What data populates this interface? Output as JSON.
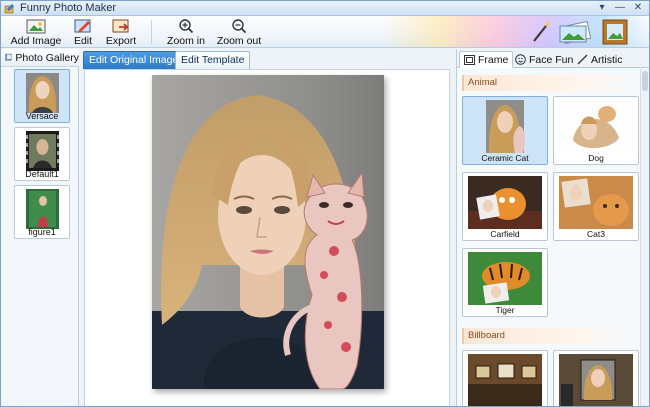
{
  "window": {
    "title": "Funny Photo Maker",
    "controls": [
      "▾",
      "—",
      "✕"
    ]
  },
  "toolbar": {
    "add_image": "Add Image",
    "edit": "Edit",
    "export": "Export",
    "zoom_in": "Zoom in",
    "zoom_out": "Zoom out"
  },
  "gallery": {
    "tab_label": "Photo Gallery",
    "items": [
      {
        "caption": "Versace",
        "selected": true
      },
      {
        "caption": "Default1",
        "selected": false
      },
      {
        "caption": "figure1",
        "selected": false
      }
    ]
  },
  "editor": {
    "tabs": [
      {
        "label": "Edit Original Image",
        "active": true
      },
      {
        "label": "Edit Template",
        "active": false
      }
    ]
  },
  "panel": {
    "tabs": [
      {
        "label": "Frame",
        "active": true
      },
      {
        "label": "Face Fun",
        "active": false
      },
      {
        "label": "Artistic",
        "active": false
      }
    ],
    "sections": [
      {
        "title": "Animal",
        "items": [
          "Ceramic Cat",
          "Dog",
          "Carfield",
          "Cat3",
          "Tiger"
        ]
      },
      {
        "title": "Billboard",
        "items": [
          "",
          ""
        ]
      }
    ]
  },
  "colors": {
    "accent": "#2c79c6",
    "section": "#8a4a1e"
  }
}
